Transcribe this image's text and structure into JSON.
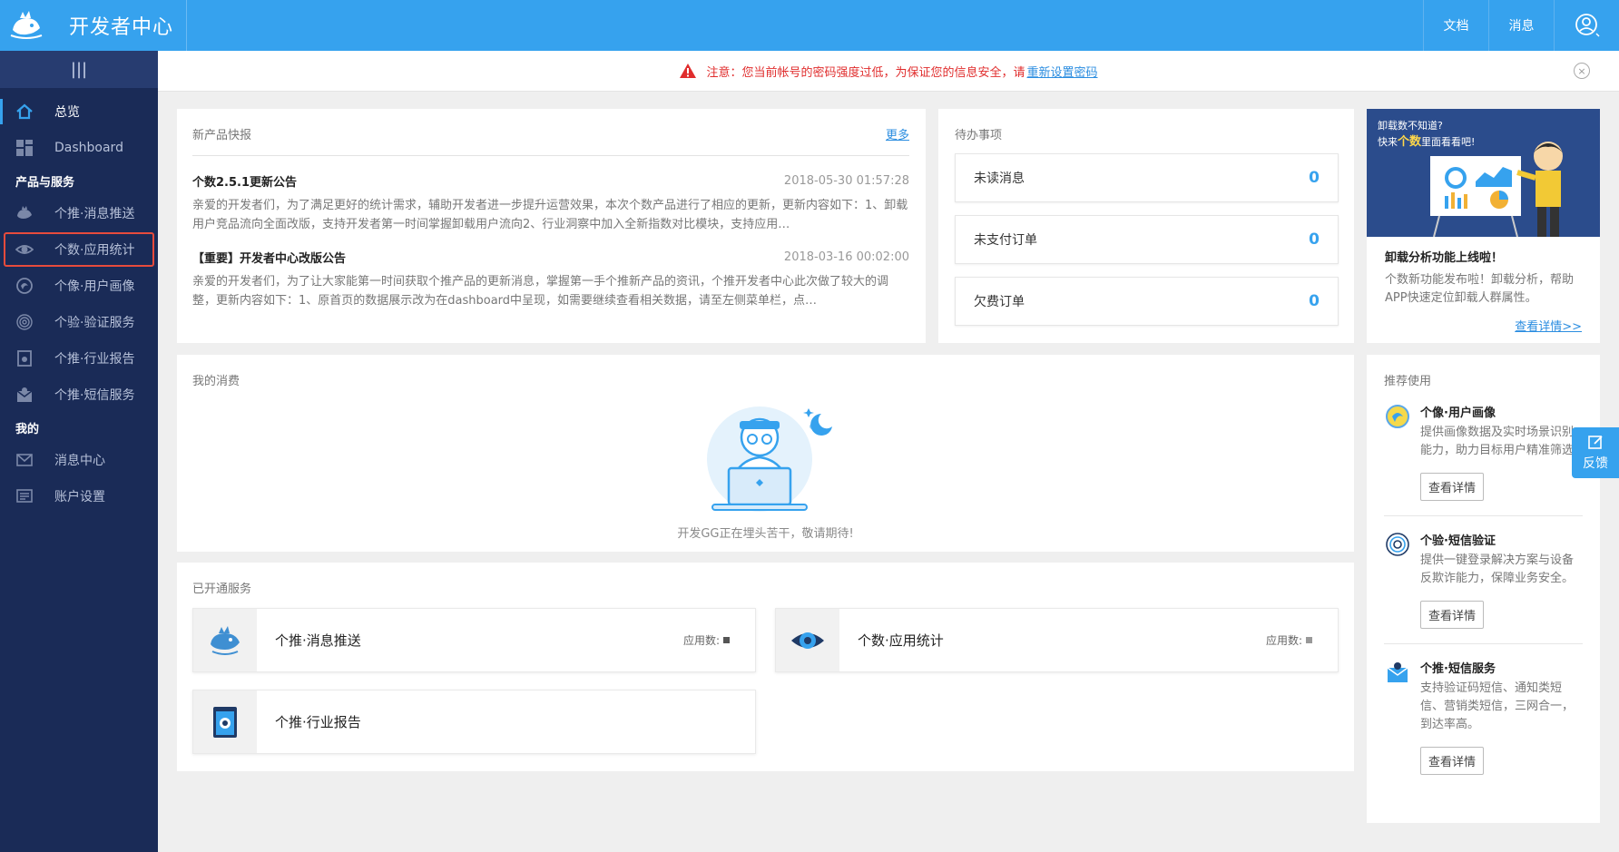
{
  "header": {
    "title": "开发者中心",
    "links": [
      "文档",
      "消息"
    ]
  },
  "sidebar": {
    "toggle_glyph": "|||",
    "items": [
      {
        "label": "总览"
      },
      {
        "label": "Dashboard"
      }
    ],
    "section_products": "产品与服务",
    "products": [
      {
        "label": "个推·消息推送"
      },
      {
        "label": "个数·应用统计"
      },
      {
        "label": "个像·用户画像"
      },
      {
        "label": "个验·验证服务"
      },
      {
        "label": "个推·行业报告"
      },
      {
        "label": "个推·短信服务"
      }
    ],
    "section_mine": "我的",
    "mine": [
      {
        "label": "消息中心"
      },
      {
        "label": "账户设置"
      }
    ]
  },
  "warning": {
    "text": "注意：您当前帐号的密码强度过低，为保证您的信息安全，请",
    "link": "重新设置密码",
    "close": "×"
  },
  "news": {
    "title": "新产品快报",
    "more": "更多",
    "items": [
      {
        "headline": "个数2.5.1更新公告",
        "date": "2018-05-30 01:57:28",
        "body": "亲爱的开发者们，为了满足更好的统计需求，辅助开发者进一步提升运营效果，本次个数产品进行了相应的更新，更新内容如下：1、卸载用户竞品流向全面改版，支持开发者第一时间掌握卸载用户流向2、行业洞察中加入全新指数对比模块，支持应用…"
      },
      {
        "headline": "【重要】开发者中心改版公告",
        "date": "2018-03-16 00:02:00",
        "body": "亲爱的开发者们，为了让大家能第一时间获取个推产品的更新消息，掌握第一手个推新产品的资讯，个推开发者中心此次做了较大的调整，更新内容如下：1、原首页的数据展示改为在dashboard中呈现，如需要继续查看相关数据，请至左侧菜单栏，点…"
      }
    ]
  },
  "todo": {
    "title": "待办事项",
    "items": [
      {
        "label": "未读消息",
        "count": "0"
      },
      {
        "label": "未支付订单",
        "count": "0"
      },
      {
        "label": "欠费订单",
        "count": "0"
      }
    ]
  },
  "promo": {
    "banner_line1": "卸载数不知道?",
    "banner_line2_pre": "快来",
    "banner_line2_hl": "个数",
    "banner_line2_post": "里面看看吧!",
    "title": "卸载分析功能上线啦！",
    "desc": "个数新功能发布啦！卸载分析，帮助APP快速定位卸载人群属性。",
    "link": "查看详情>>"
  },
  "spend": {
    "title": "我的消费",
    "caption": "开发GG正在埋头苦干，敬请期待!"
  },
  "services": {
    "title": "已开通服务",
    "meta_label": "应用数:",
    "items": [
      {
        "name": "个推·消息推送",
        "icon": "push-whale-icon"
      },
      {
        "name": "个数·应用统计",
        "icon": "eye-icon"
      },
      {
        "name": "个推·行业报告",
        "icon": "report-book-icon"
      }
    ]
  },
  "recommend": {
    "title": "推荐使用",
    "button": "查看详情",
    "items": [
      {
        "name": "个像·用户画像",
        "desc": "提供画像数据及实时场景识别能力，助力目标用户精准筛选"
      },
      {
        "name": "个验·短信验证",
        "desc": "提供一键登录解决方案与设备反欺诈能力，保障业务安全。"
      },
      {
        "name": "个推·短信服务",
        "desc": "支持验证码短信、通知类短信、营销类短信，三网合一，到达率高。"
      }
    ]
  },
  "feedback": {
    "label": "反馈"
  }
}
